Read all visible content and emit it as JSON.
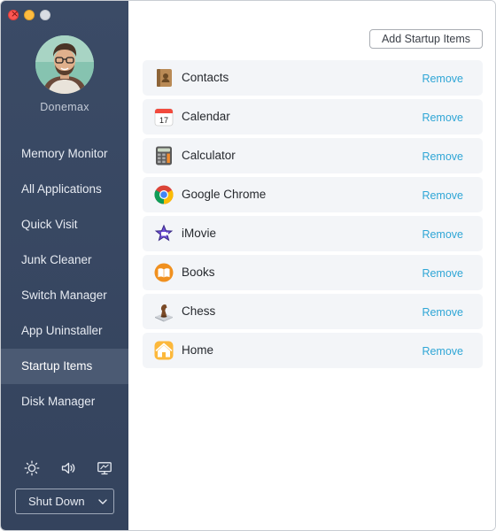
{
  "window": {
    "traffic_lights": [
      "close",
      "minimize",
      "zoom"
    ]
  },
  "sidebar": {
    "username": "Donemax",
    "items": [
      {
        "label": "Memory Monitor",
        "active": false
      },
      {
        "label": "All Applications",
        "active": false
      },
      {
        "label": "Quick Visit",
        "active": false
      },
      {
        "label": "Junk Cleaner",
        "active": false
      },
      {
        "label": "Switch Manager",
        "active": false
      },
      {
        "label": "App Uninstaller",
        "active": false
      },
      {
        "label": "Startup Items",
        "active": true
      },
      {
        "label": "Disk Manager",
        "active": false
      }
    ],
    "bottom_icons": [
      "brightness-icon",
      "volume-icon",
      "display-icon"
    ],
    "shutdown_label": "Shut Down"
  },
  "main": {
    "add_button_label": "Add Startup Items",
    "remove_label": "Remove",
    "startup_items": [
      {
        "name": "Contacts",
        "icon": "contacts-icon"
      },
      {
        "name": "Calendar",
        "icon": "calendar-icon",
        "icon_text": "17"
      },
      {
        "name": "Calculator",
        "icon": "calculator-icon"
      },
      {
        "name": "Google Chrome",
        "icon": "chrome-icon"
      },
      {
        "name": "iMovie",
        "icon": "imovie-icon"
      },
      {
        "name": "Books",
        "icon": "books-icon"
      },
      {
        "name": "Chess",
        "icon": "chess-icon"
      },
      {
        "name": "Home",
        "icon": "home-icon"
      }
    ]
  },
  "colors": {
    "sidebar_bg": "#384862",
    "sidebar_active": "#4b5a73",
    "remove_link": "#2fa6d6",
    "row_bg": "#f3f5f8"
  }
}
